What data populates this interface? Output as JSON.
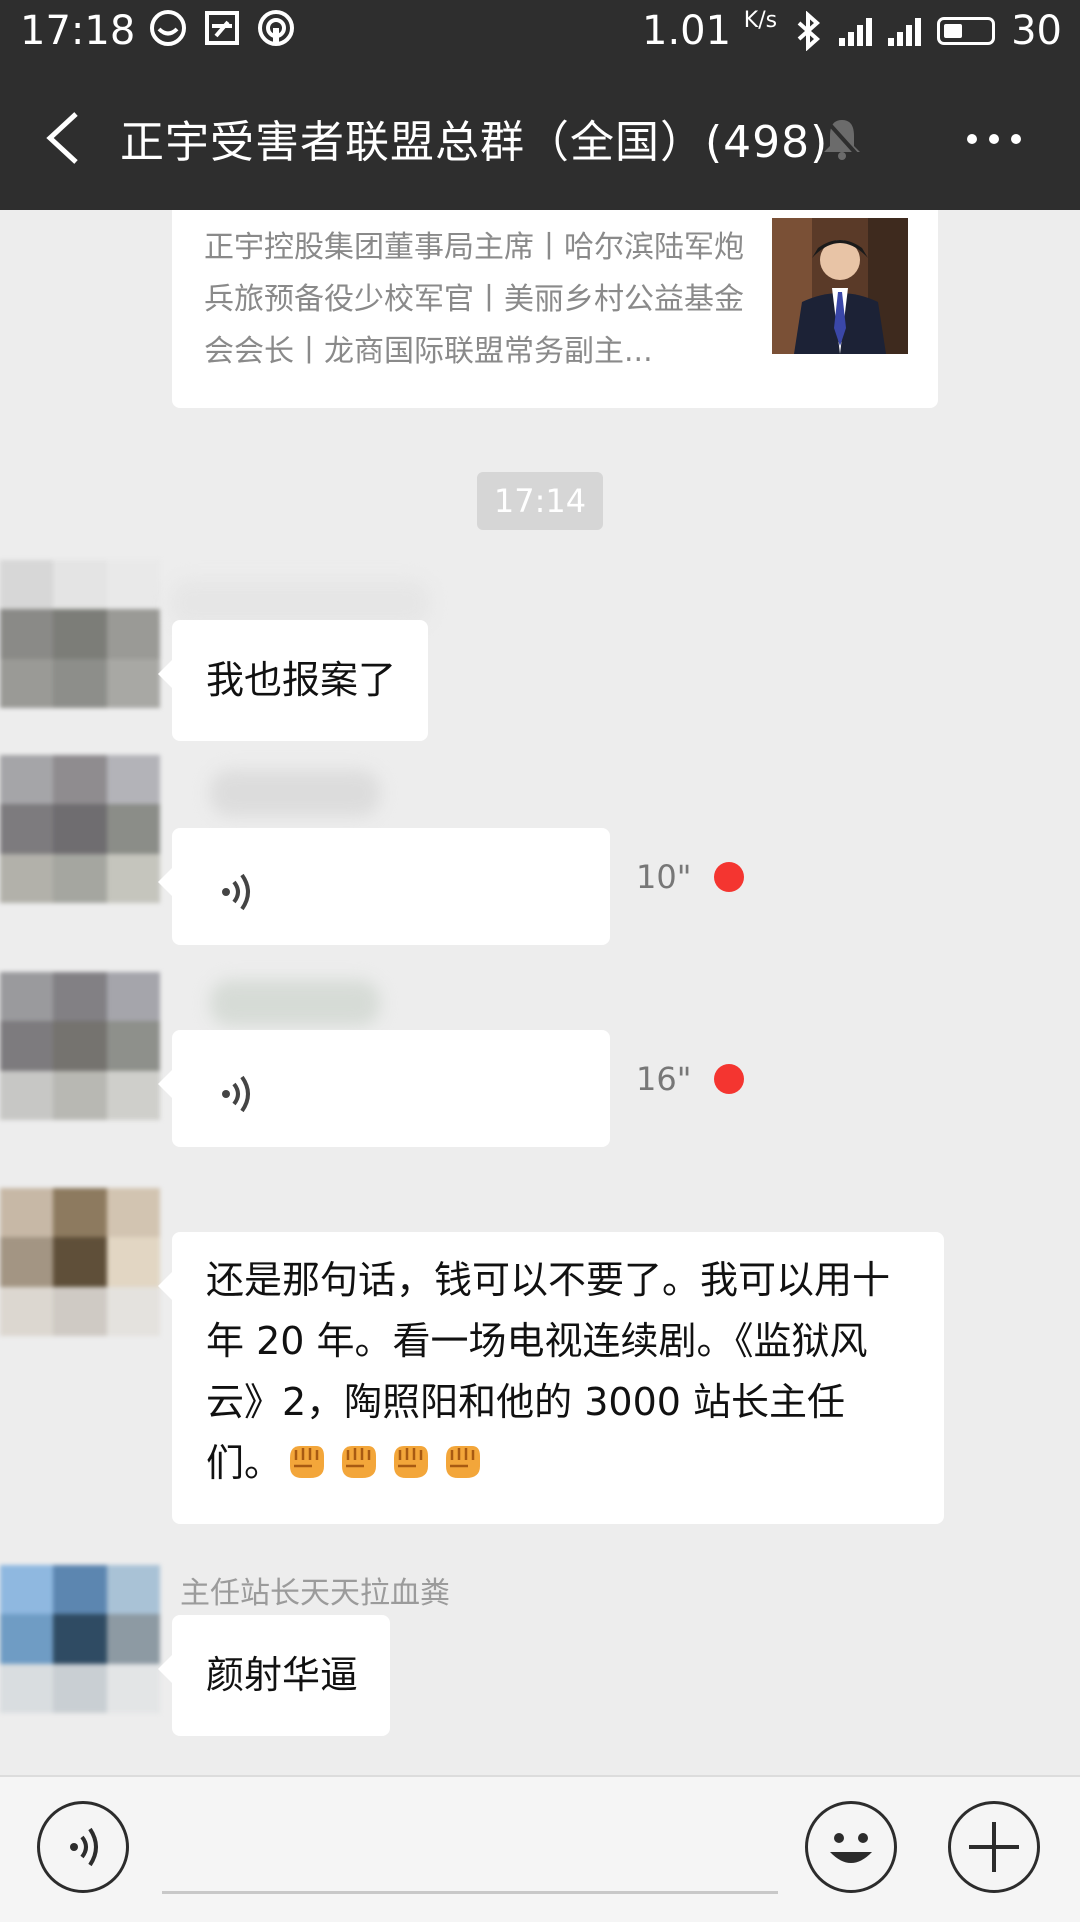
{
  "status_bar": {
    "time": "17:18",
    "net_speed": "1.01",
    "net_unit": "K/s",
    "battery": "30",
    "icons": [
      "sync-icon",
      "app-icon",
      "hotspot-icon",
      "bluetooth-icon",
      "signal-4g-icon",
      "signal-icon",
      "battery-icon"
    ]
  },
  "nav": {
    "title": "正宇受害者联盟总群（全国）(498)",
    "icons": [
      "back-arrow-icon",
      "mute-bell-icon",
      "more-icon"
    ]
  },
  "link_card": {
    "description": "正宇控股集团董事局主席丨哈尔滨陆军炮兵旅预备役少校军官丨美丽乡村公益基金会会长丨龙商国际联盟常务副主..."
  },
  "time_separator": "17:14",
  "messages": [
    {
      "type": "text",
      "text": "我也报案了"
    },
    {
      "type": "voice",
      "duration": "10\"",
      "unread": true
    },
    {
      "type": "voice",
      "duration": "16\"",
      "unread": true
    },
    {
      "type": "text",
      "text": "还是那句话，钱可以不要了。我可以用十年 20 年。看一场电视连续剧。《监狱风云》2，陶照阳和他的 3000 站长主任们。",
      "emoji": [
        "fist-emoji",
        "fist-emoji",
        "fist-emoji",
        "fist-emoji"
      ]
    },
    {
      "type": "text",
      "sender": "主任站长天天拉血粪",
      "text": "颜射华逼"
    }
  ],
  "input_bar": {
    "icons": [
      "voice-input-icon",
      "emoji-icon",
      "plus-icon"
    ]
  },
  "colors": {
    "bar_bg": "#2e2e2e",
    "chat_bg": "#ededed",
    "bubble_bg": "#ffffff",
    "unread_dot": "#f43530"
  }
}
